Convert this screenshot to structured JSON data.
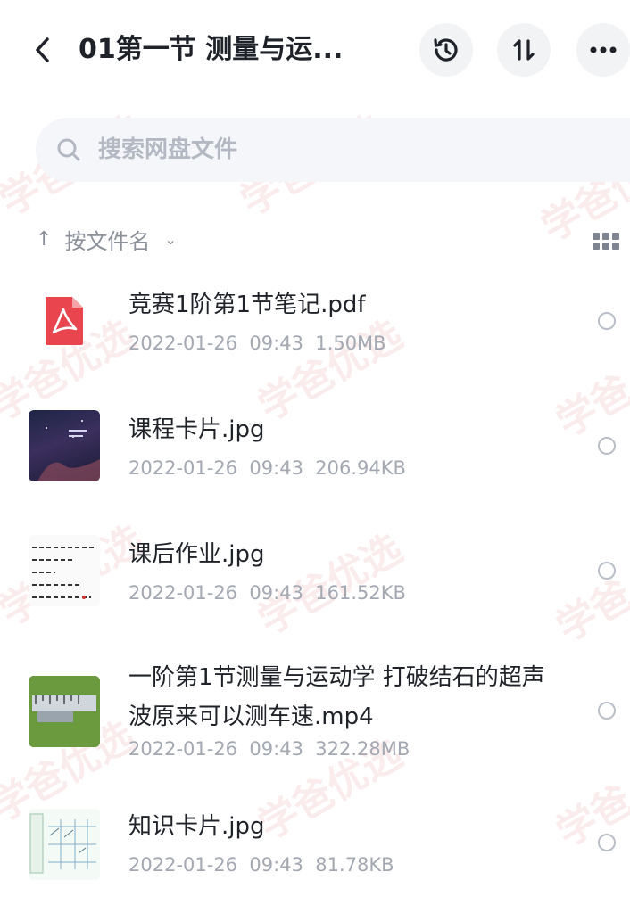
{
  "header": {
    "back_icon": "chevron-left-icon",
    "title": "01第一节 测量与运...",
    "history_icon": "history-icon",
    "sort_icon": "sort-icon",
    "more_icon": "more-icon"
  },
  "search": {
    "placeholder": "搜索网盘文件"
  },
  "sort": {
    "arrow": "↑",
    "label": "按文件名",
    "chevron": "⌄"
  },
  "files": [
    {
      "name": "竞赛1阶第1节笔记.pdf",
      "date": "2022-01-26",
      "time": "09:43",
      "size": "1.50MB",
      "thumb": "pdf-icon"
    },
    {
      "name": "课程卡片.jpg",
      "date": "2022-01-26",
      "time": "09:43",
      "size": "206.94KB",
      "thumb": "image-thumbnail"
    },
    {
      "name": "课后作业.jpg",
      "date": "2022-01-26",
      "time": "09:43",
      "size": "161.52KB",
      "thumb": "image-thumbnail"
    },
    {
      "name": "一阶第1节测量与运动学 打破结石的超声波原来可以测车速.mp4",
      "date": "2022-01-26",
      "time": "09:43",
      "size": "322.28MB",
      "thumb": "video-thumbnail"
    },
    {
      "name": "知识卡片.jpg",
      "date": "2022-01-26",
      "time": "09:43",
      "size": "81.78KB",
      "thumb": "image-thumbnail"
    }
  ],
  "watermark": {
    "text": "学爸优选"
  },
  "colors": {
    "pdf_red": "#e8454f",
    "meta_gray": "#a3a8b2",
    "search_bg": "#f4f6fa"
  }
}
